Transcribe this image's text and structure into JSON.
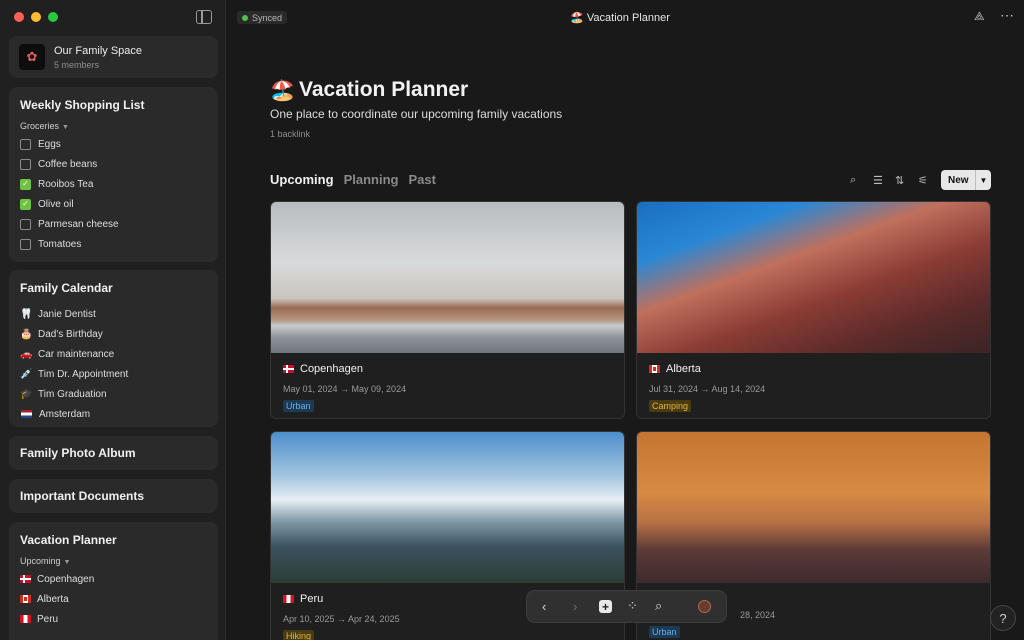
{
  "window": {
    "title": "Vacation Planner",
    "title_emoji": "🏖️",
    "sync_status": "Synced"
  },
  "colors": {
    "accent_green": "#6fc242",
    "tag_urban": "#6aaee6",
    "tag_warm": "#e0b340"
  },
  "sidebar": {
    "space": {
      "name": "Our Family Space",
      "members": "5 members"
    },
    "shopping": {
      "title": "Weekly Shopping List",
      "group": "Groceries",
      "items": [
        {
          "label": "Eggs",
          "checked": false
        },
        {
          "label": "Coffee beans",
          "checked": false
        },
        {
          "label": "Rooibos Tea",
          "checked": true
        },
        {
          "label": "Olive oil",
          "checked": true
        },
        {
          "label": "Parmesan cheese",
          "checked": false
        },
        {
          "label": "Tomatoes",
          "checked": false
        }
      ]
    },
    "calendar": {
      "title": "Family Calendar",
      "items": [
        {
          "emoji": "🦷",
          "label": "Janie Dentist"
        },
        {
          "emoji": "🎂",
          "label": "Dad's Birthday"
        },
        {
          "emoji": "🚗",
          "label": "Car maintenance"
        },
        {
          "emoji": "💉",
          "label": "Tim Dr. Appointment"
        },
        {
          "emoji": "🎓",
          "label": "Tim Graduation"
        },
        {
          "emoji": "flag-nl",
          "label": "Amsterdam"
        }
      ]
    },
    "photo_album": {
      "title": "Family Photo Album"
    },
    "documents": {
      "title": "Important Documents"
    },
    "vacation": {
      "title": "Vacation Planner",
      "group": "Upcoming",
      "items": [
        {
          "flag": "flag-dk",
          "label": "Copenhagen"
        },
        {
          "flag": "flag-ca",
          "label": "Alberta"
        },
        {
          "flag": "flag-pe",
          "label": "Peru"
        }
      ]
    }
  },
  "page": {
    "emoji": "🏖️",
    "title": "Vacation Planner",
    "description": "One place to coordinate our upcoming family vacations",
    "backlinks": "1 backlink",
    "tabs": [
      "Upcoming",
      "Planning",
      "Past"
    ],
    "new_label": "New",
    "cards": [
      {
        "flag": "flag-dk",
        "name": "Copenhagen",
        "dates": "May 01, 2024 → May 09, 2024",
        "tag": "Urban"
      },
      {
        "flag": "flag-ca",
        "name": "Alberta",
        "dates": "Jul 31, 2024 → Aug 14, 2024",
        "tag": "Camping"
      },
      {
        "flag": "flag-pe",
        "name": "Peru",
        "dates": "Apr 10, 2025 → Apr 24, 2025",
        "tag": "Hiking"
      },
      {
        "flag": "flag-nl",
        "name": "",
        "dates": "28, 2024",
        "tag": "Urban"
      }
    ]
  },
  "help_label": "?"
}
